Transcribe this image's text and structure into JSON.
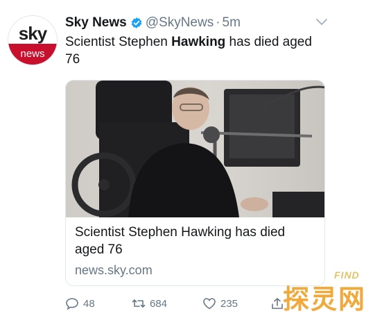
{
  "avatar": {
    "line1": "sky",
    "line2": "news",
    "brand_red": "#c8102e"
  },
  "header": {
    "display_name": "Sky News",
    "handle": "@SkyNews",
    "separator": "·",
    "time": "5m",
    "verified_icon": "verified-badge-icon",
    "verified_color": "#1da1f2",
    "caret_icon": "chevron-down-icon"
  },
  "tweet": {
    "text_before": "Scientist Stephen ",
    "text_bold": "Hawking",
    "text_after": " has died aged 76"
  },
  "card": {
    "image_icon": "photo-stephen-hawking",
    "title": "Scientist Stephen Hawking has died aged 76",
    "domain": "news.sky.com"
  },
  "actions": {
    "reply_count": "48",
    "retweet_count": "684",
    "like_count": "235",
    "reply_icon": "reply-icon",
    "retweet_icon": "retweet-icon",
    "like_icon": "heart-icon",
    "share_icon": "share-icon"
  },
  "watermark": {
    "find": "FIND",
    "glyphs": "探灵网"
  }
}
